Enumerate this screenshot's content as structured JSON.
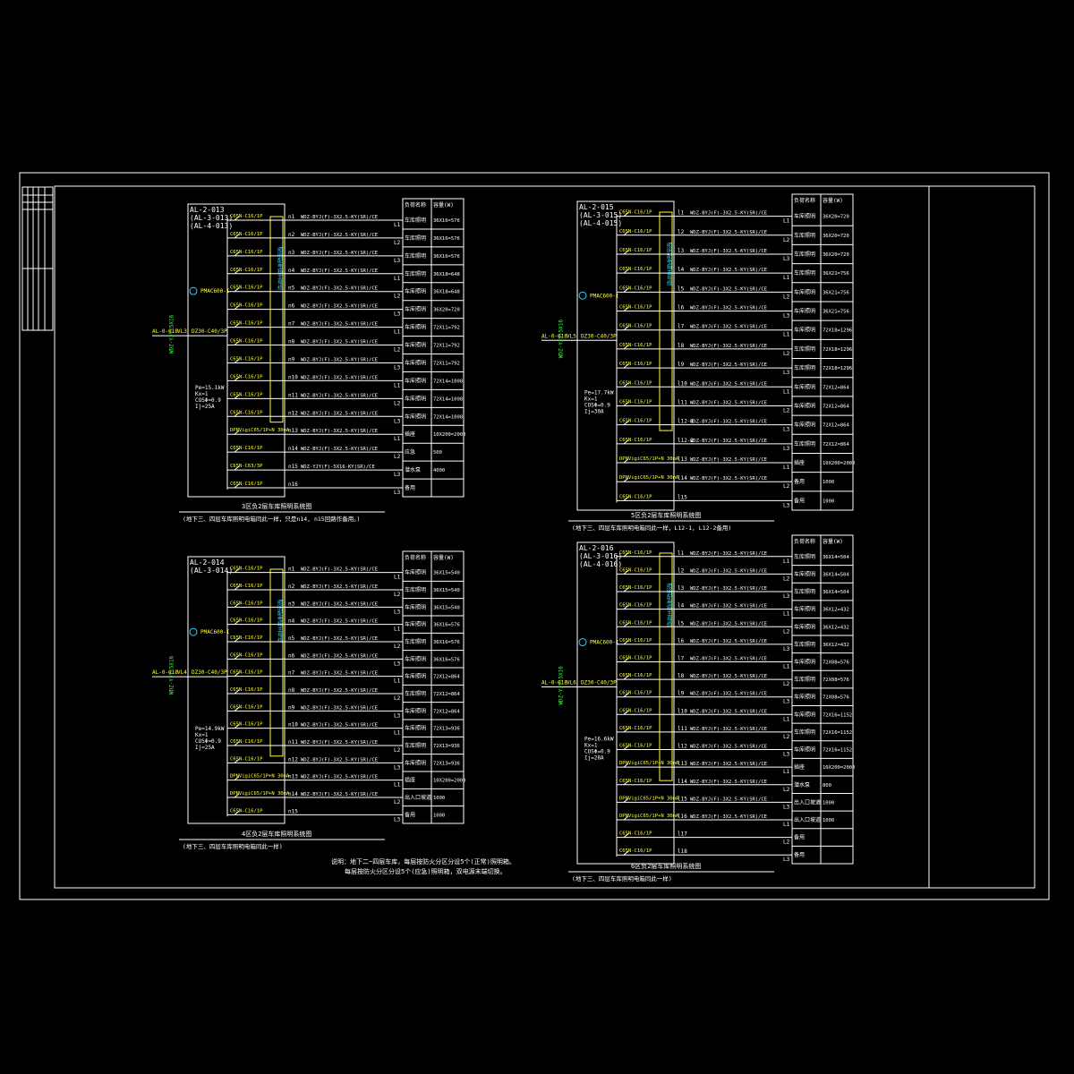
{
  "colors": {
    "background": "#000000",
    "line": "#ffffff",
    "label": "#ffff33",
    "bus": "#33ccff",
    "feeder": "#33ff33"
  },
  "panels": [
    {
      "ids": [
        "AL-2-013",
        "(AL-3-013)",
        "(AL-4-013)"
      ],
      "in_cable": "WDZ-YJY-5X16",
      "in_tag": "AL-0-018",
      "in_phase": "VL3",
      "main_breaker": "DZ30-C40/3P",
      "meter": "PMAC600-I",
      "load": [
        "Pe=15.1kW",
        "Kx=1",
        "COSΦ=0.9",
        "Ij=25A"
      ],
      "caption": "3区负2层车库照明系统图",
      "note": "(地下三、四层车库照明电箱同此一样，只是n14, n15回路作备用。)",
      "table_header": [
        "负荷名称",
        "容量(W)"
      ],
      "rows": [
        {
          "cid": "n1",
          "brk": "C65N-C16/1P",
          "cable": "WDZ-BYJ(F)-3X2.5-KY(SR)/CE",
          "ph": "L1",
          "name": "车库照明",
          "cap": "36X16=576"
        },
        {
          "cid": "n2",
          "brk": "C65N-C16/1P",
          "cable": "WDZ-BYJ(F)-3X2.5-KY(SR)/CE",
          "ph": "L2",
          "name": "车库照明",
          "cap": "36X16=576"
        },
        {
          "cid": "n3",
          "brk": "C65N-C16/1P",
          "cable": "WDZ-BYJ(F)-3X2.5-KY(SR)/CE",
          "ph": "L3",
          "name": "车库照明",
          "cap": "36X16=576"
        },
        {
          "cid": "n4",
          "brk": "C65N-C16/1P",
          "cable": "WDZ-BYJ(F)-3X2.5-KY(SR)/CE",
          "ph": "L1",
          "name": "车库照明",
          "cap": "36X18=648"
        },
        {
          "cid": "n5",
          "brk": "C65N-C16/1P",
          "cable": "WDZ-BYJ(F)-3X2.5-KY(SR)/CE",
          "ph": "L2",
          "name": "车库照明",
          "cap": "36X18=648"
        },
        {
          "cid": "n6",
          "brk": "C65N-C16/1P",
          "cable": "WDZ-BYJ(F)-3X2.5-KY(SR)/CE",
          "ph": "L3",
          "name": "车库照明",
          "cap": "36X20=720"
        },
        {
          "cid": "n7",
          "brk": "C65N-C16/1P",
          "cable": "WDZ-BYJ(F)-3X2.5-KY(SR)/CE",
          "ph": "L1",
          "name": "车库照明",
          "cap": "72X11=792"
        },
        {
          "cid": "n8",
          "brk": "C65N-C16/1P",
          "cable": "WDZ-BYJ(F)-3X2.5-KY(SR)/CE",
          "ph": "L2",
          "name": "车库照明",
          "cap": "72X11=792"
        },
        {
          "cid": "n9",
          "brk": "C65N-C16/1P",
          "cable": "WDZ-BYJ(F)-3X2.5-KY(SR)/CE",
          "ph": "L3",
          "name": "车库照明",
          "cap": "72X11=792"
        },
        {
          "cid": "n10",
          "brk": "C65N-C16/1P",
          "cable": "WDZ-BYJ(F)-3X2.5-KY(SR)/CE",
          "ph": "L1",
          "name": "车库照明",
          "cap": "72X14=1008"
        },
        {
          "cid": "n11",
          "brk": "C65N-C16/1P",
          "cable": "WDZ-BYJ(F)-3X2.5-KY(SR)/CE",
          "ph": "L2",
          "name": "车库照明",
          "cap": "72X14=1008"
        },
        {
          "cid": "n12",
          "brk": "C65N-C16/1P",
          "cable": "WDZ-BYJ(F)-3X2.5-KY(SR)/CE",
          "ph": "L3",
          "name": "车库照明",
          "cap": "72X14=1008"
        },
        {
          "cid": "n13",
          "brk": "DPNVigiC65/1P+N 30mA",
          "cable": "WDZ-BYJ(F)-3X2.5-KY(SR)/CE",
          "ph": "L1",
          "name": "插座",
          "cap": "10X200=2000"
        },
        {
          "cid": "n14",
          "brk": "C65N-C16/1P",
          "cable": "WDZ-BYJ(F)-3X2.5-KY(SR)/CE",
          "ph": "L2",
          "name": "应急",
          "cap": "500"
        },
        {
          "cid": "n15",
          "brk": "C65N-C63/3P",
          "cable": "WDZ-YJY(F)-5X16-KY(SR)/CE",
          "ph": "L3",
          "name": "潜水泵",
          "cap": "4000"
        },
        {
          "cid": "n16",
          "brk": "C65N-C16/1P",
          "cable": "",
          "ph": "L3",
          "name": "备用",
          "cap": ""
        }
      ]
    },
    {
      "ids": [
        "AL-2-015",
        "(AL-3-015)",
        "(AL-4-015)"
      ],
      "in_cable": "WDZ-YJY-5X16",
      "in_tag": "AL-0-018",
      "in_phase": "VL5",
      "main_breaker": "DZ30-C40/3P",
      "meter": "PMAC600-I",
      "load": [
        "Pe=17.7kW",
        "Kx=1",
        "COSΦ=0.9",
        "Ij=30A"
      ],
      "caption": "5区负2层车库照明系统图",
      "note": "(地下三、四层车库照明电箱同此一样，L12-1, L12-2备用)",
      "table_header": [
        "负荷名称",
        "容量(W)"
      ],
      "rows": [
        {
          "cid": "l1",
          "brk": "C65N-C16/1P",
          "cable": "WDZ-BYJ(F)-3X2.5-KY(SR)/CE",
          "ph": "L1",
          "name": "车库照明",
          "cap": "36X20=720"
        },
        {
          "cid": "l2",
          "brk": "C65N-C16/1P",
          "cable": "WDZ-BYJ(F)-3X2.5-KY(SR)/CE",
          "ph": "L2",
          "name": "车库照明",
          "cap": "36X20=720"
        },
        {
          "cid": "l3",
          "brk": "C65N-C16/1P",
          "cable": "WDZ-BYJ(F)-3X2.5-KY(SR)/CE",
          "ph": "L3",
          "name": "车库照明",
          "cap": "36X20=720"
        },
        {
          "cid": "l4",
          "brk": "C65N-C16/1P",
          "cable": "WDZ-BYJ(F)-3X2.5-KY(SR)/CE",
          "ph": "L1",
          "name": "车库照明",
          "cap": "36X21=756"
        },
        {
          "cid": "l5",
          "brk": "C65N-C16/1P",
          "cable": "WDZ-BYJ(F)-3X2.5-KY(SR)/CE",
          "ph": "L2",
          "name": "车库照明",
          "cap": "36X21=756"
        },
        {
          "cid": "l6",
          "brk": "C65N-C16/1P",
          "cable": "WDZ-BYJ(F)-3X2.5-KY(SR)/CE",
          "ph": "L3",
          "name": "车库照明",
          "cap": "36X21=756"
        },
        {
          "cid": "l7",
          "brk": "C65N-C16/1P",
          "cable": "WDZ-BYJ(F)-3X2.5-KY(SR)/CE",
          "ph": "L1",
          "name": "车库照明",
          "cap": "72X18=1296"
        },
        {
          "cid": "l8",
          "brk": "C65N-C16/1P",
          "cable": "WDZ-BYJ(F)-3X2.5-KY(SR)/CE",
          "ph": "L2",
          "name": "车库照明",
          "cap": "72X18=1296"
        },
        {
          "cid": "l9",
          "brk": "C65N-C16/1P",
          "cable": "WDZ-BYJ(F)-3X2.5-KY(SR)/CE",
          "ph": "L3",
          "name": "车库照明",
          "cap": "72X18=1296"
        },
        {
          "cid": "l10",
          "brk": "C65N-C16/1P",
          "cable": "WDZ-BYJ(F)-3X2.5-KY(SR)/CE",
          "ph": "L1",
          "name": "车库照明",
          "cap": "72X12=864"
        },
        {
          "cid": "l11",
          "brk": "C65N-C16/1P",
          "cable": "WDZ-BYJ(F)-3X2.5-KY(SR)/CE",
          "ph": "L2",
          "name": "车库照明",
          "cap": "72X12=864"
        },
        {
          "cid": "l12-1",
          "brk": "C65N-C16/1P",
          "cable": "WDZ-BYJ(F)-3X2.5-KY(SR)/CE",
          "ph": "L3",
          "name": "车库照明",
          "cap": "72X12=864"
        },
        {
          "cid": "l12-2",
          "brk": "C65N-C16/1P",
          "cable": "WDZ-BYJ(F)-3X2.5-KY(SR)/CE",
          "ph": "L3",
          "name": "车库照明",
          "cap": "72X12=864"
        },
        {
          "cid": "l13",
          "brk": "DPNVigiC65/1P+N 30mA",
          "cable": "WDZ-BYJ(F)-3X2.5-KY(SR)/CE",
          "ph": "L1",
          "name": "插座",
          "cap": "10X200=2000"
        },
        {
          "cid": "l14",
          "brk": "DPNVigiC65/1P+N 30mA",
          "cable": "WDZ-BYJ(F)-3X2.5-KY(SR)/CE",
          "ph": "L2",
          "name": "备用",
          "cap": "1000"
        },
        {
          "cid": "l15",
          "brk": "C65N-C16/1P",
          "cable": "",
          "ph": "L3",
          "name": "备用",
          "cap": "1000"
        }
      ]
    },
    {
      "ids": [
        "AL-2-014",
        "(AL-3-014)"
      ],
      "in_cable": "WDZ-YJY-5X16",
      "in_tag": "AL-0-018",
      "in_phase": "VL4",
      "main_breaker": "DZ30-C40/3P",
      "meter": "PMAC600-I",
      "load": [
        "Pe=14.9kW",
        "Kx=1",
        "COSΦ=0.9",
        "Ij=25A"
      ],
      "caption": "4区负2层车库照明系统图",
      "note": "(地下三、四层车库照明电箱同此一样)",
      "table_header": [
        "负荷名称",
        "容量(W)"
      ],
      "rows": [
        {
          "cid": "n1",
          "brk": "C65N-C16/1P",
          "cable": "WDZ-BYJ(F)-3X2.5-KY(SR)/CE",
          "ph": "L1",
          "name": "车库照明",
          "cap": "36X15=540"
        },
        {
          "cid": "n2",
          "brk": "C65N-C16/1P",
          "cable": "WDZ-BYJ(F)-3X2.5-KY(SR)/CE",
          "ph": "L2",
          "name": "车库照明",
          "cap": "36X15=540"
        },
        {
          "cid": "n3",
          "brk": "C65N-C16/1P",
          "cable": "WDZ-BYJ(F)-3X2.5-KY(SR)/CE",
          "ph": "L3",
          "name": "车库照明",
          "cap": "36X15=540"
        },
        {
          "cid": "n4",
          "brk": "C65N-C16/1P",
          "cable": "WDZ-BYJ(F)-3X2.5-KY(SR)/CE",
          "ph": "L1",
          "name": "车库照明",
          "cap": "36X16=576"
        },
        {
          "cid": "n5",
          "brk": "C65N-C16/1P",
          "cable": "WDZ-BYJ(F)-3X2.5-KY(SR)/CE",
          "ph": "L2",
          "name": "车库照明",
          "cap": "36X16=576"
        },
        {
          "cid": "n6",
          "brk": "C65N-C16/1P",
          "cable": "WDZ-BYJ(F)-3X2.5-KY(SR)/CE",
          "ph": "L3",
          "name": "车库照明",
          "cap": "36X16=576"
        },
        {
          "cid": "n7",
          "brk": "C65N-C16/1P",
          "cable": "WDZ-BYJ(F)-3X2.5-KY(SR)/CE",
          "ph": "L1",
          "name": "车库照明",
          "cap": "72X12=864"
        },
        {
          "cid": "n8",
          "brk": "C65N-C16/1P",
          "cable": "WDZ-BYJ(F)-3X2.5-KY(SR)/CE",
          "ph": "L2",
          "name": "车库照明",
          "cap": "72X12=864"
        },
        {
          "cid": "n9",
          "brk": "C65N-C16/1P",
          "cable": "WDZ-BYJ(F)-3X2.5-KY(SR)/CE",
          "ph": "L3",
          "name": "车库照明",
          "cap": "72X12=864"
        },
        {
          "cid": "n10",
          "brk": "C65N-C16/1P",
          "cable": "WDZ-BYJ(F)-3X2.5-KY(SR)/CE",
          "ph": "L1",
          "name": "车库照明",
          "cap": "72X13=936"
        },
        {
          "cid": "n11",
          "brk": "C65N-C16/1P",
          "cable": "WDZ-BYJ(F)-3X2.5-KY(SR)/CE",
          "ph": "L2",
          "name": "车库照明",
          "cap": "72X13=936"
        },
        {
          "cid": "n12",
          "brk": "C65N-C16/1P",
          "cable": "WDZ-BYJ(F)-3X2.5-KY(SR)/CE",
          "ph": "L3",
          "name": "车库照明",
          "cap": "72X13=936"
        },
        {
          "cid": "n13",
          "brk": "DPNVigiC65/1P+N 30mA",
          "cable": "WDZ-BYJ(F)-3X2.5-KY(SR)/CE",
          "ph": "L1",
          "name": "插座",
          "cap": "10X200=2000"
        },
        {
          "cid": "n14",
          "brk": "DPNVigiC65/1P+N 30mA",
          "cable": "WDZ-BYJ(F)-3X2.5-KY(SR)/CE",
          "ph": "L2",
          "name": "出入口坡道",
          "cap": "1000"
        },
        {
          "cid": "n15",
          "brk": "C65N-C16/1P",
          "cable": "",
          "ph": "L3",
          "name": "备用",
          "cap": "1000"
        }
      ]
    },
    {
      "ids": [
        "AL-2-016",
        "(AL-3-016)",
        "(AL-4-016)"
      ],
      "in_cable": "WDZ-YJY-5X16",
      "in_tag": "AL-0-018",
      "in_phase": "VL6",
      "main_breaker": "DZ30-C40/3P",
      "meter": "PMAC600-I",
      "load": [
        "Pe=16.6kW",
        "Kx=1",
        "COSΦ=0.9",
        "Ij=28A"
      ],
      "caption": "6区负2层车库照明系统图",
      "note": "(地下三、四层车库照明电箱同此一样)",
      "table_header": [
        "负荷名称",
        "容量(W)"
      ],
      "rows": [
        {
          "cid": "l1",
          "brk": "C65N-C16/1P",
          "cable": "WDZ-BYJ(F)-3X2.5-KY(SR)/CE",
          "ph": "L1",
          "name": "车库照明",
          "cap": "36X14=504"
        },
        {
          "cid": "l2",
          "brk": "C65N-C16/1P",
          "cable": "WDZ-BYJ(F)-3X2.5-KY(SR)/CE",
          "ph": "L2",
          "name": "车库照明",
          "cap": "36X14=504"
        },
        {
          "cid": "l3",
          "brk": "C65N-C16/1P",
          "cable": "WDZ-BYJ(F)-3X2.5-KY(SR)/CE",
          "ph": "L3",
          "name": "车库照明",
          "cap": "36X14=504"
        },
        {
          "cid": "l4",
          "brk": "C65N-C16/1P",
          "cable": "WDZ-BYJ(F)-3X2.5-KY(SR)/CE",
          "ph": "L1",
          "name": "车库照明",
          "cap": "36X12=432"
        },
        {
          "cid": "l5",
          "brk": "C65N-C16/1P",
          "cable": "WDZ-BYJ(F)-3X2.5-KY(SR)/CE",
          "ph": "L2",
          "name": "车库照明",
          "cap": "36X12=432"
        },
        {
          "cid": "l6",
          "brk": "C65N-C16/1P",
          "cable": "WDZ-BYJ(F)-3X2.5-KY(SR)/CE",
          "ph": "L3",
          "name": "车库照明",
          "cap": "36X12=432"
        },
        {
          "cid": "l7",
          "brk": "C65N-C16/1P",
          "cable": "WDZ-BYJ(F)-3X2.5-KY(SR)/CE",
          "ph": "L1",
          "name": "车库照明",
          "cap": "72X08=576"
        },
        {
          "cid": "l8",
          "brk": "C65N-C16/1P",
          "cable": "WDZ-BYJ(F)-3X2.5-KY(SR)/CE",
          "ph": "L2",
          "name": "车库照明",
          "cap": "72X08=576"
        },
        {
          "cid": "l9",
          "brk": "C65N-C16/1P",
          "cable": "WDZ-BYJ(F)-3X2.5-KY(SR)/CE",
          "ph": "L3",
          "name": "车库照明",
          "cap": "72X08=576"
        },
        {
          "cid": "l10",
          "brk": "C65N-C16/1P",
          "cable": "WDZ-BYJ(F)-3X2.5-KY(SR)/CE",
          "ph": "L1",
          "name": "车库照明",
          "cap": "72X16=1152"
        },
        {
          "cid": "l11",
          "brk": "C65N-C16/1P",
          "cable": "WDZ-BYJ(F)-3X2.5-KY(SR)/CE",
          "ph": "L2",
          "name": "车库照明",
          "cap": "72X16=1152"
        },
        {
          "cid": "l12",
          "brk": "C65N-C16/1P",
          "cable": "WDZ-BYJ(F)-3X2.5-KY(SR)/CE",
          "ph": "L3",
          "name": "车库照明",
          "cap": "72X16=1152"
        },
        {
          "cid": "l13",
          "brk": "DPNVigiC65/1P+N 30mA",
          "cable": "WDZ-BYJ(F)-3X2.5-KY(SR)/CE",
          "ph": "L1",
          "name": "插座",
          "cap": "10X200=2000"
        },
        {
          "cid": "l14",
          "brk": "C65N-C16/1P",
          "cable": "WDZ-BYJ(F)-3X2.5-KY(SR)/CE",
          "ph": "L2",
          "name": "潜水泵",
          "cap": "800"
        },
        {
          "cid": "l15",
          "brk": "DPNVigiC65/1P+N 30mA",
          "cable": "WDZ-BYJ(F)-3X2.5-KY(SR)/CE",
          "ph": "L3",
          "name": "出入口坡道",
          "cap": "1000"
        },
        {
          "cid": "l16",
          "brk": "DPNVigiC65/1P+N 30mA",
          "cable": "WDZ-BYJ(F)-3X2.5-KY(SR)/CE",
          "ph": "L1",
          "name": "出入口坡道",
          "cap": "1000"
        },
        {
          "cid": "l17",
          "brk": "C65N-C16/1P",
          "cable": "",
          "ph": "L2",
          "name": "备用",
          "cap": ""
        },
        {
          "cid": "l18",
          "brk": "C65N-C16/1P",
          "cable": "",
          "ph": "L3",
          "name": "备用",
          "cap": ""
        }
      ]
    }
  ],
  "general_note": [
    "说明：地下二~四层车库，每层按防火分区分设5个(正常)照明箱。",
    "每层按防火分区分设5个(应急)照明箱，双电源末端切换。"
  ],
  "bus_label": "照明配电箱主母线"
}
